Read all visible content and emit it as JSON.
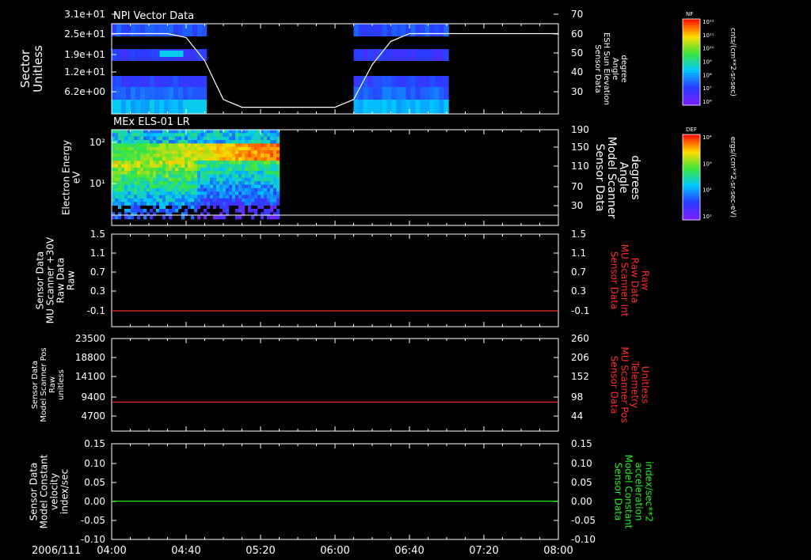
{
  "date_label": "2006/111",
  "x_ticks": [
    "04:00",
    "04:40",
    "05:20",
    "06:00",
    "06:40",
    "07:20",
    "08:00"
  ],
  "colors": {
    "red": "#ff2a2a",
    "green": "#22ee22",
    "white": "#ffffff",
    "frame": "#ffffff"
  },
  "panels": [
    {
      "title": "NPI Vector Data",
      "left_label": [
        "Sector",
        "Unitless"
      ],
      "left_ticks": [
        "3.1e+01",
        "2.5e+01",
        "1.9e+01",
        "1.2e+01",
        "6.2e+00"
      ],
      "right_ticks": [
        "70",
        "60",
        "50",
        "40",
        "30"
      ],
      "right_label": [
        "Sensor Data",
        "ESH Sun Elevation",
        "Angle",
        "degree"
      ],
      "right_label_color": "#ffffff",
      "colorbar": {
        "name": "NF",
        "units": "cnts/(cm**2-sr-sec)",
        "tick_labels": [
          "10¹²",
          "10¹¹",
          "10¹⁰",
          "10⁹",
          "10⁸",
          "10⁷",
          "10⁶"
        ]
      }
    },
    {
      "title": "MEx ELS-01 LR",
      "left_label": [
        "Electron Energy",
        "eV"
      ],
      "left_ticks": [
        "10²",
        "10¹"
      ],
      "right_ticks": [
        "190",
        "150",
        "110",
        "70",
        "30"
      ],
      "right_label": [
        "Sensor Data",
        "Model Scanner",
        "Angle",
        "degrees"
      ],
      "right_label_color": "#ffffff",
      "colorbar": {
        "name": "DEF",
        "units": "ergs/(cm**2-sr-sec-eV)",
        "tick_labels": [
          "10⁴",
          "10³",
          "10²",
          "10¹"
        ]
      }
    },
    {
      "title": "",
      "left_label": [
        "Sensor Data",
        "MU Scanner +30V",
        "Raw Data",
        "Raw"
      ],
      "left_ticks": [
        "1.5",
        "1.1",
        "0.7",
        "0.3",
        "-0.1"
      ],
      "right_ticks": [
        "1.5",
        "1.1",
        "0.7",
        "0.3",
        "-0.1"
      ],
      "right_label": [
        "Sensor Data",
        "MU Scanner Int",
        "Raw Data",
        "Raw"
      ],
      "right_label_color": "#ff2a2a"
    },
    {
      "title": "",
      "left_label": [
        "Sensor Data",
        "Model Scanner Pos",
        "Raw",
        "unitless"
      ],
      "left_ticks": [
        "23500",
        "18800",
        "14100",
        "9400",
        "4700"
      ],
      "right_ticks": [
        "260",
        "206",
        "152",
        "98",
        "44"
      ],
      "right_label": [
        "Sensor Data",
        "MU Scanner Pos",
        "Telemetry",
        "Unitless"
      ],
      "right_label_color": "#ff2a2a"
    },
    {
      "title": "",
      "left_label": [
        "Sensor Data",
        "Model Constant",
        "velocity",
        "index/sec"
      ],
      "left_ticks": [
        "0.15",
        "0.10",
        "0.05",
        "0.00",
        "-0.05",
        "-0.10"
      ],
      "right_ticks": [
        "0.15",
        "0.10",
        "0.05",
        "0.00",
        "-0.05",
        "-0.10"
      ],
      "right_label": [
        "Sensor Data",
        "Model Constant",
        "acceleration",
        "index/sec**2"
      ],
      "right_label_color": "#22ee22"
    }
  ],
  "chart_data": [
    {
      "type": "heatmap",
      "title": "NPI Vector Data",
      "x_range": [
        "04:00",
        "08:00"
      ],
      "ylabel": "Sector Unitless",
      "ylim": [
        0,
        31
      ],
      "data_coverage": [
        [
          "04:00",
          "04:50"
        ],
        [
          "06:10",
          "07:00"
        ]
      ],
      "overlay_line": {
        "name": "Sensor Data ESH Sun Elevation Angle",
        "units": "degree",
        "ylim": [
          20,
          70
        ],
        "x": [
          "04:00",
          "04:30",
          "04:40",
          "04:50",
          "05:00",
          "05:10",
          "06:00",
          "06:10",
          "06:20",
          "06:30",
          "06:40",
          "08:00"
        ],
        "y": [
          60,
          60,
          58,
          46,
          26,
          22,
          22,
          26,
          44,
          56,
          60,
          60
        ]
      }
    },
    {
      "type": "heatmap",
      "title": "MEx ELS-01 LR",
      "x_range": [
        "04:00",
        "08:00"
      ],
      "ylabel": "Electron Energy eV",
      "yscale": "log",
      "data_coverage": [
        [
          "04:00",
          "05:30"
        ]
      ],
      "overlay_line": {
        "name": "Sensor Data Model Scanner Angle",
        "units": "degrees",
        "ylim": [
          0,
          190
        ],
        "x": [
          "04:00",
          "08:00"
        ],
        "y": [
          10,
          10
        ]
      }
    },
    {
      "type": "line",
      "series": [
        {
          "name": "Sensor Data MU Scanner Int Raw Data Raw",
          "color": "#ff2a2a",
          "x": [
            "04:00",
            "08:00"
          ],
          "y": [
            -0.1,
            -0.1
          ]
        }
      ],
      "ylim": [
        -0.4,
        1.5
      ]
    },
    {
      "type": "line",
      "series": [
        {
          "name": "Sensor Data MU Scanner Pos Telemetry Unitless",
          "color": "#ff2a2a",
          "x": [
            "04:00",
            "08:00"
          ],
          "y": [
            83,
            83
          ]
        }
      ],
      "ylim": [
        0,
        260
      ]
    },
    {
      "type": "line",
      "series": [
        {
          "name": "Sensor Data Model Constant acceleration index/sec**2",
          "color": "#22ee22",
          "x": [
            "04:00",
            "08:00"
          ],
          "y": [
            0.0,
            0.0
          ]
        }
      ],
      "ylim": [
        -0.1,
        0.15
      ]
    }
  ]
}
